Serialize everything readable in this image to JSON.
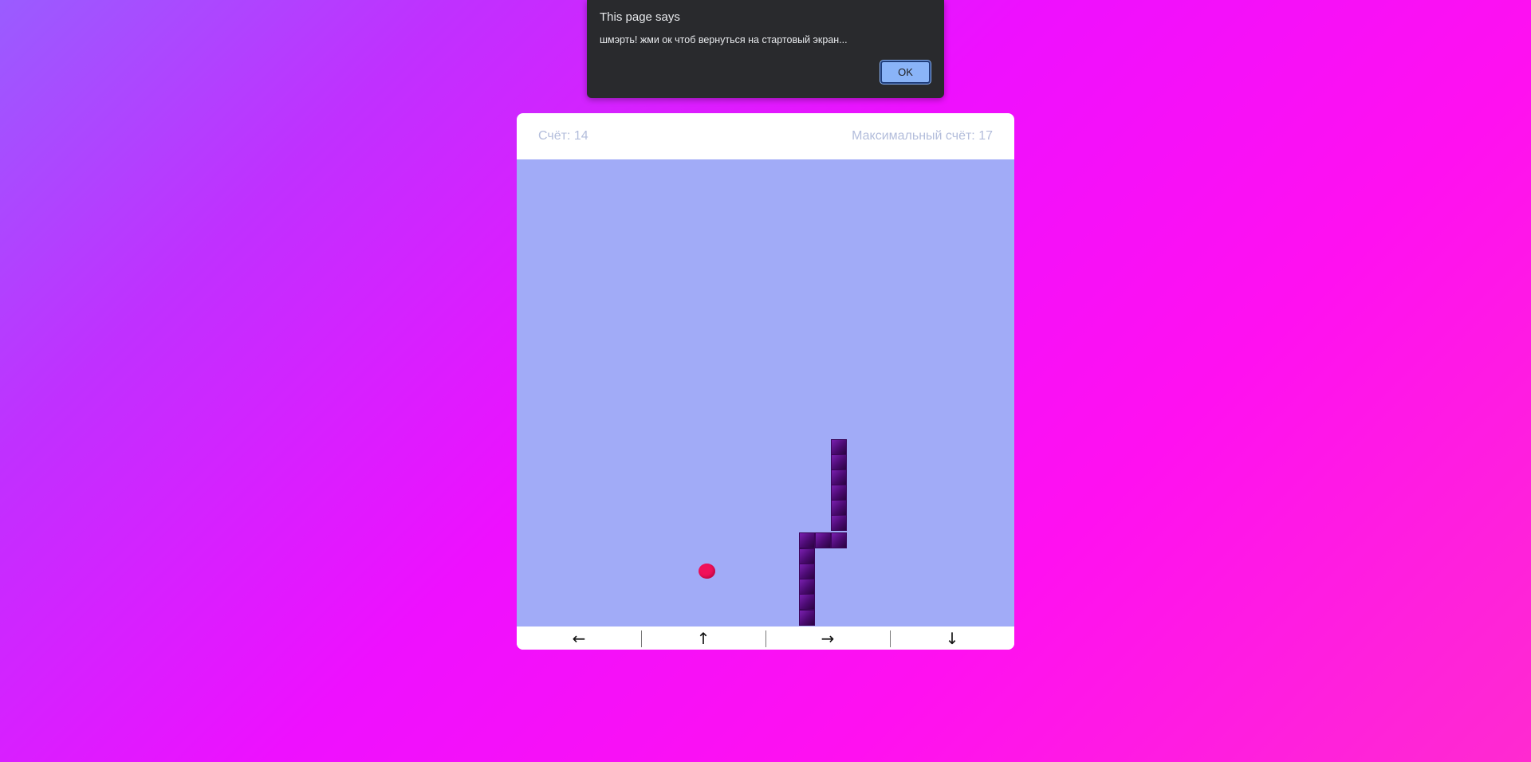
{
  "dialog": {
    "title": "This page says",
    "message": "шмэрть! жми ок чтоб вернуться на стартовый экран...",
    "ok_label": "OK"
  },
  "game": {
    "score_label": "Счёт: 14",
    "max_score_label": "Максимальный счёт: 17",
    "score": 14,
    "max_score": 17,
    "field_color": "#a1abf7",
    "snake_color": "#4a0a70",
    "food_color": "#f0105a"
  },
  "controls": {
    "left_label": "←",
    "up_label": "↑",
    "right_label": "→",
    "down_label": "↓"
  }
}
